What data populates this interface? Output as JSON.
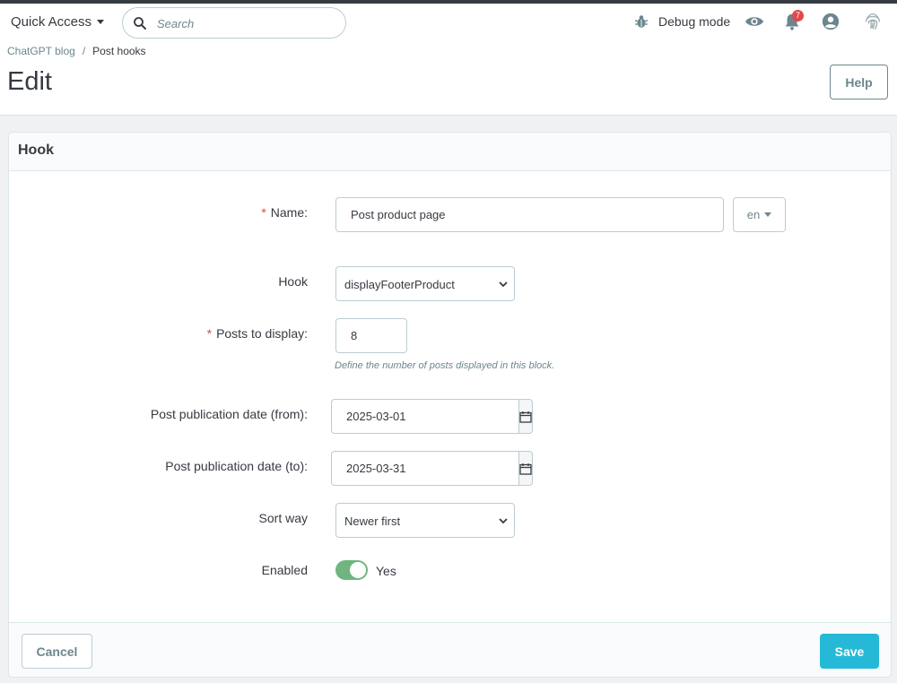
{
  "header": {
    "quick_access_label": "Quick Access",
    "search_placeholder": "Search",
    "debug_label": "Debug mode",
    "notification_count": "7",
    "icons": [
      "bug-icon",
      "eye-icon",
      "bell-icon",
      "user-icon",
      "fingerprint-icon"
    ]
  },
  "breadcrumb": {
    "parent": "ChatGPT blog",
    "separator": "/",
    "current": "Post hooks"
  },
  "page": {
    "title": "Edit",
    "help_label": "Help"
  },
  "panel": {
    "title": "Hook",
    "fields": {
      "name": {
        "label": "Name:",
        "value": "Post product page",
        "lang": "en"
      },
      "hook": {
        "label": "Hook",
        "value": "displayFooterProduct"
      },
      "posts_to_display": {
        "label": "Posts to display:",
        "value": "8",
        "help": "Define the number of posts displayed in this block."
      },
      "date_from": {
        "label": "Post publication date (from):",
        "value": "2025-03-01"
      },
      "date_to": {
        "label": "Post publication date (to):",
        "value": "2025-03-31"
      },
      "sort_way": {
        "label": "Sort way",
        "value": "Newer first"
      },
      "enabled": {
        "label": "Enabled",
        "value": "Yes"
      }
    },
    "required_mark": "*"
  },
  "footer": {
    "cancel_label": "Cancel",
    "save_label": "Save"
  },
  "colors": {
    "primary": "#25b9d7",
    "toggle_on": "#70b580",
    "required": "#e0494a",
    "badge": "#e0494a",
    "topbar_stripe": "#363a41"
  }
}
